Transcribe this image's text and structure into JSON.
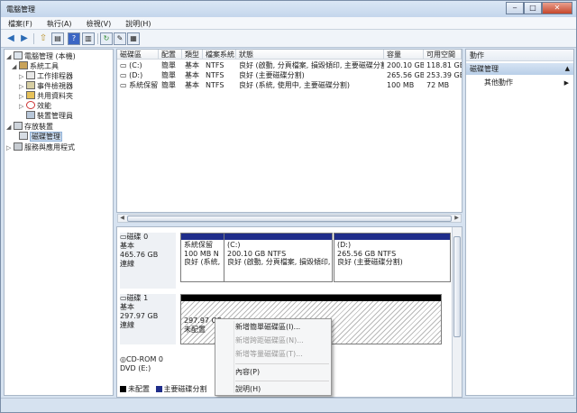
{
  "window": {
    "title": "電腦管理"
  },
  "menubar": [
    "檔案(F)",
    "執行(A)",
    "檢視(V)",
    "說明(H)"
  ],
  "tree": [
    {
      "label": "電腦管理 (本機)",
      "icon": "computer-icon",
      "arrow": "◢"
    },
    {
      "label": "系統工具",
      "icon": "tools-icon",
      "arrow": "◢"
    },
    {
      "label": "工作排程器",
      "icon": "clock-icon",
      "arrow": "▷"
    },
    {
      "label": "事件檢視器",
      "icon": "event-icon",
      "arrow": "▷"
    },
    {
      "label": "共用資料夾",
      "icon": "folder-icon",
      "arrow": "▷"
    },
    {
      "label": "效能",
      "icon": "performance-icon",
      "arrow": "▷"
    },
    {
      "label": "裝置管理員",
      "icon": "device-icon",
      "arrow": ""
    },
    {
      "label": "存放裝置",
      "icon": "storage-icon",
      "arrow": "◢"
    },
    {
      "label": "磁碟管理",
      "icon": "disk-icon",
      "arrow": ""
    },
    {
      "label": "服務與應用程式",
      "icon": "services-icon",
      "arrow": "▷"
    }
  ],
  "volume_list": {
    "columns": [
      "磁碟區",
      "配置",
      "類型",
      "檔案系統",
      "狀態",
      "容量",
      "可用空間"
    ],
    "rows": [
      [
        "(C:)",
        "簡單",
        "基本",
        "NTFS",
        "良好 (啟動, 分頁檔案, 損毀傾印, 主要磁碟分割)",
        "200.10 GB",
        "118.81 GB"
      ],
      [
        "(D:)",
        "簡單",
        "基本",
        "NTFS",
        "良好 (主要磁碟分割)",
        "265.56 GB",
        "253.39 GB"
      ],
      [
        "系統保留",
        "簡單",
        "基本",
        "NTFS",
        "良好 (系統, 使用中, 主要磁碟分割)",
        "100 MB",
        "72 MB"
      ]
    ]
  },
  "disks": [
    {
      "name": "磁碟 0",
      "type": "基本",
      "size": "465.76 GB",
      "status": "連線",
      "partitions": [
        {
          "name": "系統保留",
          "size": "100 MB N",
          "status": "良好 (系統, "
        },
        {
          "name": "(C:)",
          "size": "200.10 GB NTFS",
          "status": "良好 (啟動, 分頁檔案, 損毀傾印, 主"
        },
        {
          "name": "(D:)",
          "size": "265.56 GB NTFS",
          "status": "良好 (主要磁碟分割)"
        }
      ]
    },
    {
      "name": "磁碟 1",
      "type": "基本",
      "size": "297.97 GB",
      "status": "連線",
      "partitions": [
        {
          "size": "297.97 GB",
          "status": "未配置"
        }
      ]
    },
    {
      "name": "CD-ROM 0",
      "type": "DVD (E:)"
    }
  ],
  "legend": [
    {
      "label": "未配置",
      "color": "#000000"
    },
    {
      "label": "主要磁碟分割",
      "color": "#1f2d8a"
    }
  ],
  "context_menu": [
    {
      "label": "新增簡單磁碟區(I)...",
      "enabled": true
    },
    {
      "label": "新增跨距磁碟區(N)...",
      "enabled": false
    },
    {
      "label": "新增等量磁碟區(T)...",
      "enabled": false
    },
    {
      "label": "內容(P)",
      "enabled": true
    },
    {
      "label": "說明(H)",
      "enabled": true
    }
  ],
  "actions": {
    "header": "動作",
    "section": "磁碟管理",
    "item": "其他動作"
  }
}
